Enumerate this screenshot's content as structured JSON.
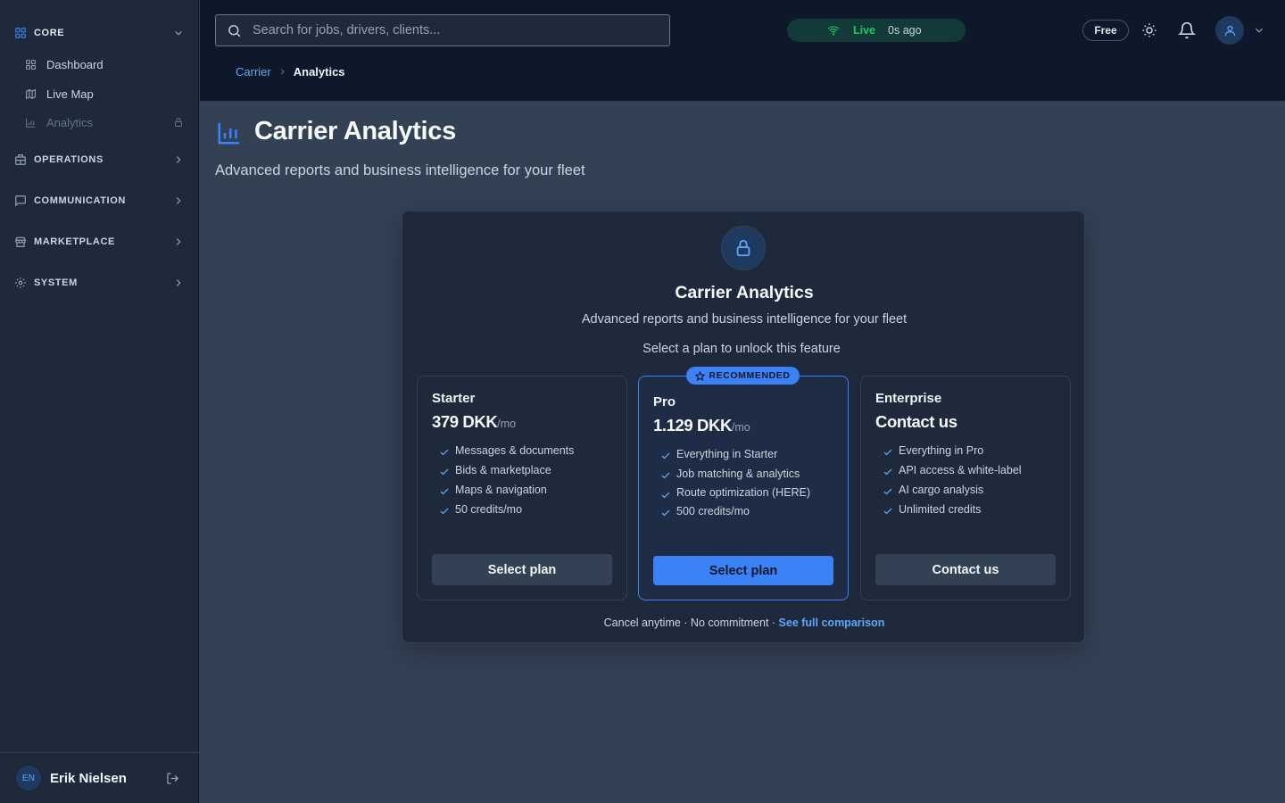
{
  "sidebar": {
    "sections": {
      "core": {
        "label": "CORE",
        "icon": "grid-icon"
      },
      "operations": {
        "label": "OPERATIONS",
        "icon": "building-icon"
      },
      "communication": {
        "label": "COMMUNICATION",
        "icon": "message-icon"
      },
      "marketplace": {
        "label": "MARKETPLACE",
        "icon": "store-icon"
      },
      "system": {
        "label": "SYSTEM",
        "icon": "gear-icon"
      }
    },
    "items": [
      {
        "label": "Dashboard",
        "icon": "grid-icon"
      },
      {
        "label": "Live Map",
        "icon": "map-icon"
      },
      {
        "label": "Analytics",
        "icon": "bar-chart-icon",
        "locked": true
      }
    ],
    "user": {
      "initials": "EN",
      "name": "Erik Nielsen"
    }
  },
  "topbar": {
    "search_placeholder": "Search for jobs, drivers, clients...",
    "live_label": "Live",
    "live_ago": "0s ago",
    "plan_badge": "Free"
  },
  "breadcrumb": {
    "parent": "Carrier",
    "current": "Analytics"
  },
  "page": {
    "title": "Carrier Analytics",
    "subtitle": "Advanced reports and business intelligence for your fleet"
  },
  "upgrade": {
    "title": "Carrier Analytics",
    "subtitle": "Advanced reports and business intelligence for your fleet",
    "select_prompt": "Select a plan to unlock this feature",
    "recommended": "RECOMMENDED",
    "plans": [
      {
        "name": "Starter",
        "price": "379 DKK",
        "period": "/mo",
        "features": [
          "Messages & documents",
          "Bids & marketplace",
          "Maps & navigation",
          "50 credits/mo"
        ],
        "button": "Select plan"
      },
      {
        "name": "Pro",
        "price": "1.129 DKK",
        "period": "/mo",
        "features": [
          "Everything in Starter",
          "Job matching & analytics",
          "Route optimization (HERE)",
          "500 credits/mo"
        ],
        "button": "Select plan"
      },
      {
        "name": "Enterprise",
        "price": "Contact us",
        "period": "",
        "features": [
          "Everything in Pro",
          "API access & white-label",
          "AI cargo analysis",
          "Unlimited credits"
        ],
        "button": "Contact us"
      }
    ],
    "footer_text": "Cancel anytime · No commitment · ",
    "footer_link": "See full comparison"
  },
  "colors": {
    "accent": "#3b82f6",
    "live": "#22c55e",
    "background": "#334155",
    "sidebar": "#1e293b",
    "topbar": "#0f172a"
  }
}
